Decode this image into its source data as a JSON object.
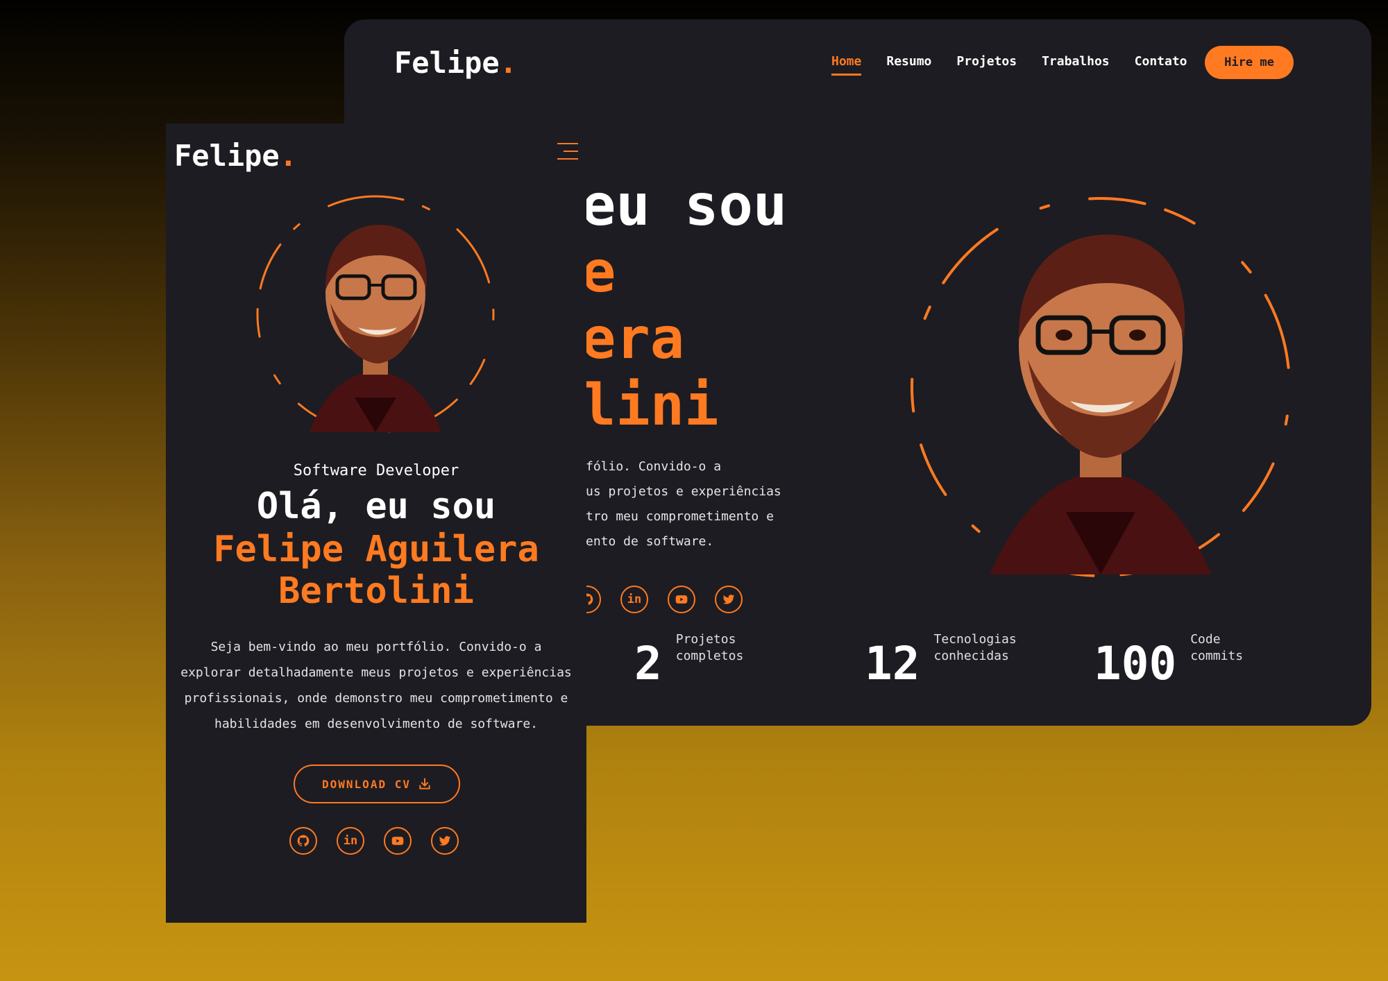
{
  "desktop": {
    "logo": "Felipe",
    "logo_dot": ".",
    "nav": [
      "Home",
      "Resumo",
      "Projetos",
      "Trabalhos",
      "Contato"
    ],
    "hire_label": "Hire me",
    "hero_lines": [
      "eu sou",
      "e",
      "era",
      "lini"
    ],
    "description_lines": [
      "fólio. Convido-o a",
      "us projetos e experiências",
      "tro meu comprometimento e",
      "ento de software."
    ],
    "stats": [
      {
        "value": "2",
        "label1": "Projetos",
        "label2": "completos"
      },
      {
        "value": "12",
        "label1": "Tecnologias",
        "label2": "conhecidas"
      },
      {
        "value": "100",
        "label1": "Code",
        "label2": "commits"
      }
    ]
  },
  "mobile": {
    "logo": "Felipe",
    "logo_dot": ".",
    "role": "Software Developer",
    "greeting": "Olá, eu sou",
    "name_line1": "Felipe Aguilera",
    "name_line2": "Bertolini",
    "description_lines": [
      "Seja bem-vindo ao meu portfólio. Convido-o a",
      "explorar detalhadamente meus projetos e experiências",
      "profissionais, onde demonstro meu comprometimento e",
      "habilidades em desenvolvimento de software."
    ],
    "download_label": "DOWNLOAD CV"
  },
  "social_icons": [
    "github-icon",
    "linkedin-icon",
    "youtube-icon",
    "twitter-icon"
  ],
  "colors": {
    "accent": "#ff7a21",
    "card_bg": "#1d1c22",
    "text": "#ffffff"
  }
}
